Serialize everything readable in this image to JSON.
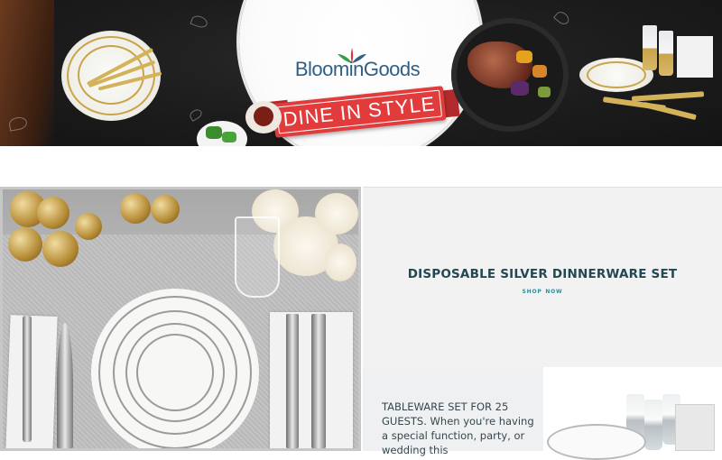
{
  "banner": {
    "brand_name": "BloominGoods",
    "tagline": "DINE IN STYLE",
    "colors": {
      "background": "#1c1c1c",
      "brand_text": "#2f5f86",
      "ribbon": "#e23b3c",
      "gold": "#c9a44a"
    }
  },
  "promo": {
    "title": "DISPOSABLE SILVER DINNERWARE SET",
    "link_label": "Shop Now",
    "colors": {
      "title": "#234753",
      "link": "#2a8f9d",
      "background": "#f2f2f2"
    }
  },
  "description": {
    "text": "TABLEWARE SET FOR 25 GUESTS. When you're having a special function, party, or wedding this"
  },
  "icons": [
    "logo-leaf-icon"
  ]
}
